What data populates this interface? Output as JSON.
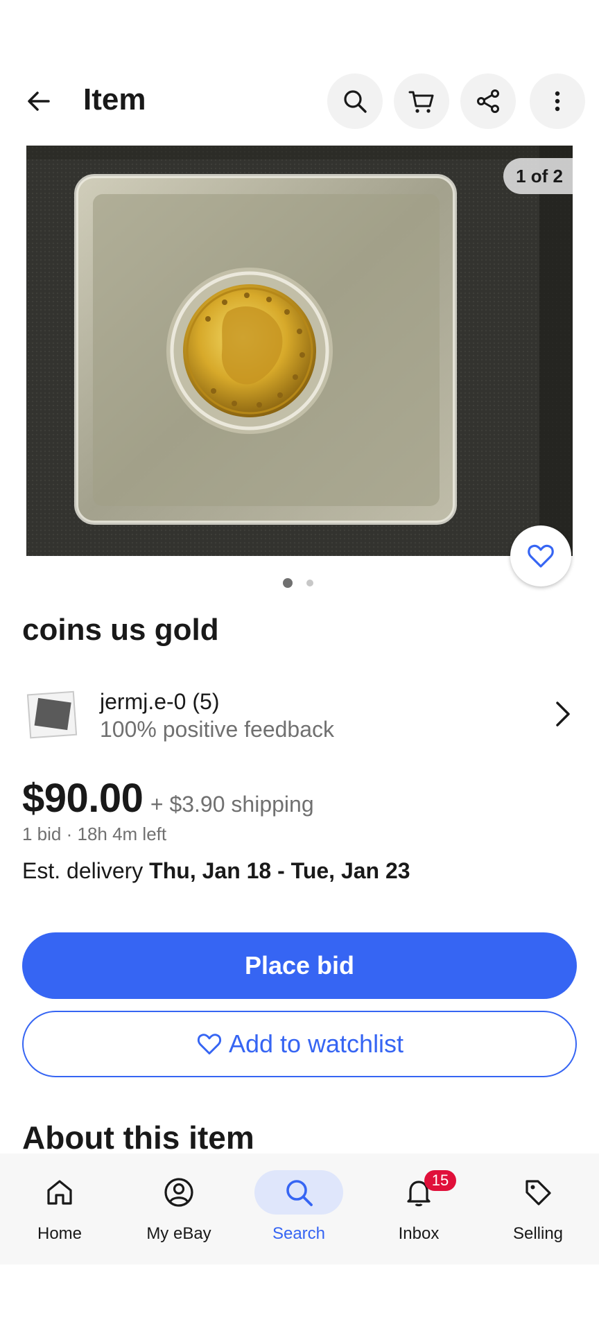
{
  "header": {
    "title": "Item",
    "icons": [
      "back-arrow-icon",
      "search-icon",
      "cart-icon",
      "share-icon",
      "more-vert-icon"
    ]
  },
  "gallery": {
    "counter": "1 of 2",
    "total": 2,
    "active": 1
  },
  "item": {
    "title": "coins us gold"
  },
  "seller": {
    "name": "jermj.e-0 (5)",
    "feedback": "100% positive feedback"
  },
  "pricing": {
    "price": "$90.00",
    "shipping": "+ $3.90 shipping",
    "bid_info": "1 bid · 18h 4m left",
    "delivery_label": "Est. delivery",
    "delivery_dates": "Thu, Jan 18 - Tue, Jan 23"
  },
  "actions": {
    "place_bid": "Place bid",
    "add_watchlist": "Add to watchlist"
  },
  "section": {
    "about": "About this item"
  },
  "nav": {
    "items": [
      {
        "label": "Home",
        "icon": "home-icon"
      },
      {
        "label": "My eBay",
        "icon": "account-icon"
      },
      {
        "label": "Search",
        "icon": "search-icon",
        "active": true
      },
      {
        "label": "Inbox",
        "icon": "bell-icon",
        "badge": "15"
      },
      {
        "label": "Selling",
        "icon": "tag-icon"
      }
    ]
  },
  "colors": {
    "accent": "#3665f3",
    "badge": "#e0103a",
    "nav_active_bg": "#dfe6fb"
  }
}
